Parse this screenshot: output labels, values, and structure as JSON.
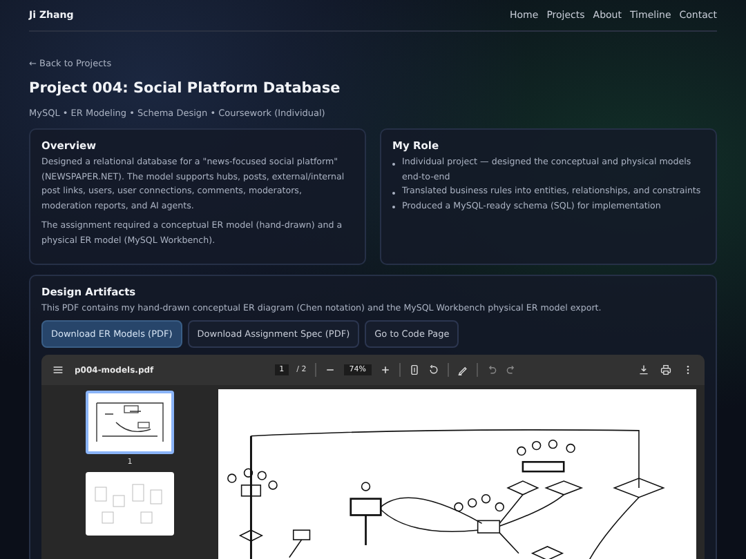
{
  "header": {
    "brand": "Ji Zhang",
    "nav": [
      {
        "label": "Home"
      },
      {
        "label": "Projects"
      },
      {
        "label": "About"
      },
      {
        "label": "Timeline"
      },
      {
        "label": "Contact"
      }
    ]
  },
  "back_link": "← Back to Projects",
  "title": "Project 004: Social Platform Database",
  "tags": "MySQL • ER Modeling • Schema Design • Coursework (Individual)",
  "overview": {
    "heading": "Overview",
    "paragraphs": [
      "Designed a relational database for a \"news-focused social platform\" (NEWSPAPER.NET). The model supports hubs, posts, external/internal post links, users, user connections, comments, moderators, moderation reports, and AI agents.",
      "The assignment required a conceptual ER model (hand-drawn) and a physical ER model (MySQL Workbench)."
    ]
  },
  "role": {
    "heading": "My Role",
    "items": [
      "Individual project — designed the conceptual and physical models end-to-end",
      "Translated business rules into entities, relationships, and constraints",
      "Produced a MySQL-ready schema (SQL) for implementation"
    ]
  },
  "artifacts": {
    "heading": "Design Artifacts",
    "description": "This PDF contains my hand-drawn conceptual ER diagram (Chen notation) and the MySQL Workbench physical ER model export.",
    "buttons": [
      {
        "label": "Download ER Models (PDF)",
        "kind": "primary"
      },
      {
        "label": "Download Assignment Spec (PDF)",
        "kind": "secondary"
      },
      {
        "label": "Go to Code Page",
        "kind": "secondary"
      }
    ],
    "pdf_viewer": {
      "file_name": "p004-models.pdf",
      "page_input": "1",
      "page_total": "/ 2",
      "zoom": "74%",
      "thumbnails": [
        {
          "label": "1",
          "selected": true,
          "kind": "diagram"
        },
        {
          "selected": false,
          "kind": "schema"
        }
      ]
    }
  }
}
